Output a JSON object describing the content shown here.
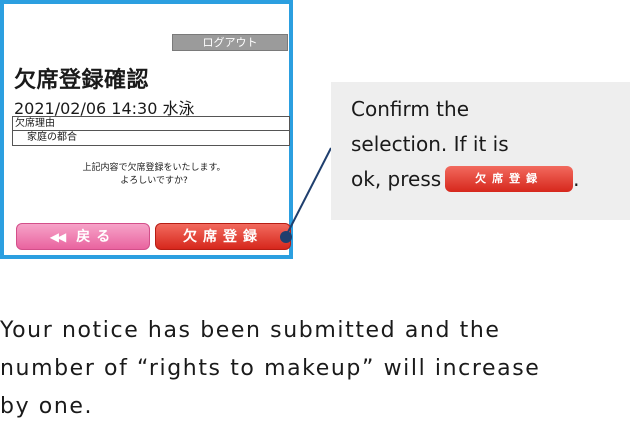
{
  "screen": {
    "logout_label": "ログアウト",
    "title": "欠席登録確認",
    "datetime": "2021/02/06 14:30 水泳",
    "reason_label": "欠席理由",
    "reason_value": "家庭の都合",
    "message_line1": "上記内容で欠席登録をいたします。",
    "message_line2": "よろしいですか?",
    "back_arrows": "◀◀",
    "back_label": "戻る",
    "register_label": "欠席登録"
  },
  "callout": {
    "line1": "Confirm the",
    "line2": "selection. If it is",
    "line3_prefix": "ok, press",
    "button_label": "欠席登録",
    "line3_suffix": "."
  },
  "footer": {
    "line1": "Your notice has been submitted and the",
    "line2": "number of “rights to makeup” will increase",
    "line3": "by one."
  },
  "colors": {
    "frame": "#2b9fe0",
    "register": "#e0392e",
    "back": "#ee7bb0",
    "logout": "#9b9b9b",
    "callout_bg": "#eeeeee",
    "pointer": "#1f3f6e"
  }
}
